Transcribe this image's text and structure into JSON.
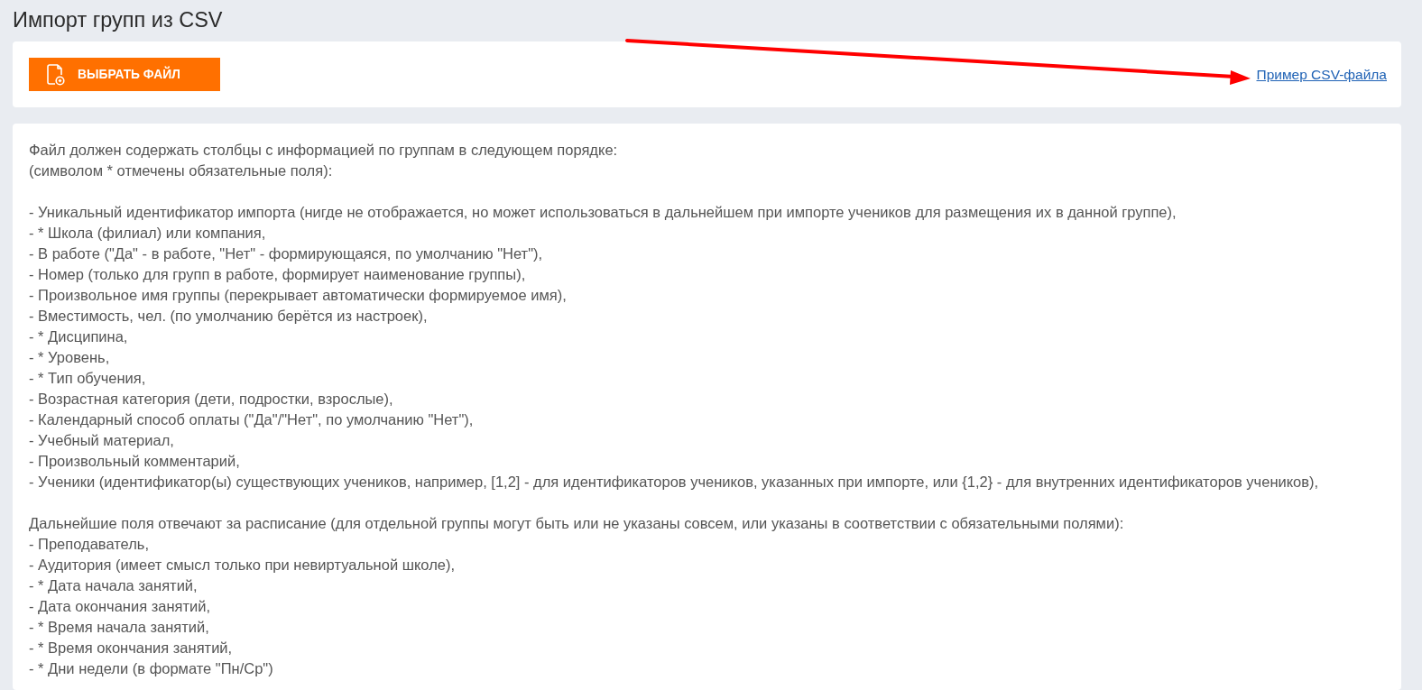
{
  "page": {
    "title": "Импорт групп из CSV"
  },
  "upload_card": {
    "button": {
      "label": "ВЫБРАТЬ ФАЙЛ"
    },
    "link": {
      "label": "Пример CSV-файла"
    }
  },
  "instructions": {
    "intro": [
      "Файл должен содержать столбцы с информацией по группам в следующем порядке:",
      "(символом * отмечены обязательные поля):"
    ],
    "columns": [
      "- Уникальный идентификатор импорта (нигде не отображается, но может использоваться в дальнейшем при импорте учеников для размещения их в данной группе),",
      "- * Школа (филиал) или компания,",
      "- В работе (\"Да\" - в работе, \"Нет\" - формирующаяся, по умолчанию \"Нет\"),",
      "- Номер (только для групп в работе, формирует наименование группы),",
      "- Произвольное имя группы (перекрывает автоматически формируемое имя),",
      "- Вместимость, чел. (по умолчанию берётся из настроек),",
      "- * Дисципина,",
      "- * Уровень,",
      "- * Тип обучения,",
      "- Возрастная категория (дети, подростки, взрослые),",
      "- Календарный способ оплаты (\"Да\"/\"Нет\", по умолчанию \"Нет\"),",
      "- Учебный материал,",
      "- Произвольный комментарий,",
      "- Ученики (идентификатор(ы) существующих учеников, например, [1,2] - для идентификаторов учеников, указанных при импорте, или {1,2} - для внутренних идентификаторов учеников),"
    ],
    "schedule_note": "Дальнейшие поля отвечают за расписание (для отдельной группы могут быть или не указаны совсем, или указаны в соответствии с обязательными полями):",
    "schedule_columns": [
      "- Преподаватель,",
      "- Аудитория (имеет смысл только при невиртуальной школе),",
      "- * Дата начала занятий,",
      "- Дата окончания занятий,",
      "- * Время начала занятий,",
      "- * Время окончания занятий,",
      "- * Дни недели (в формате \"Пн/Ср\")"
    ]
  }
}
